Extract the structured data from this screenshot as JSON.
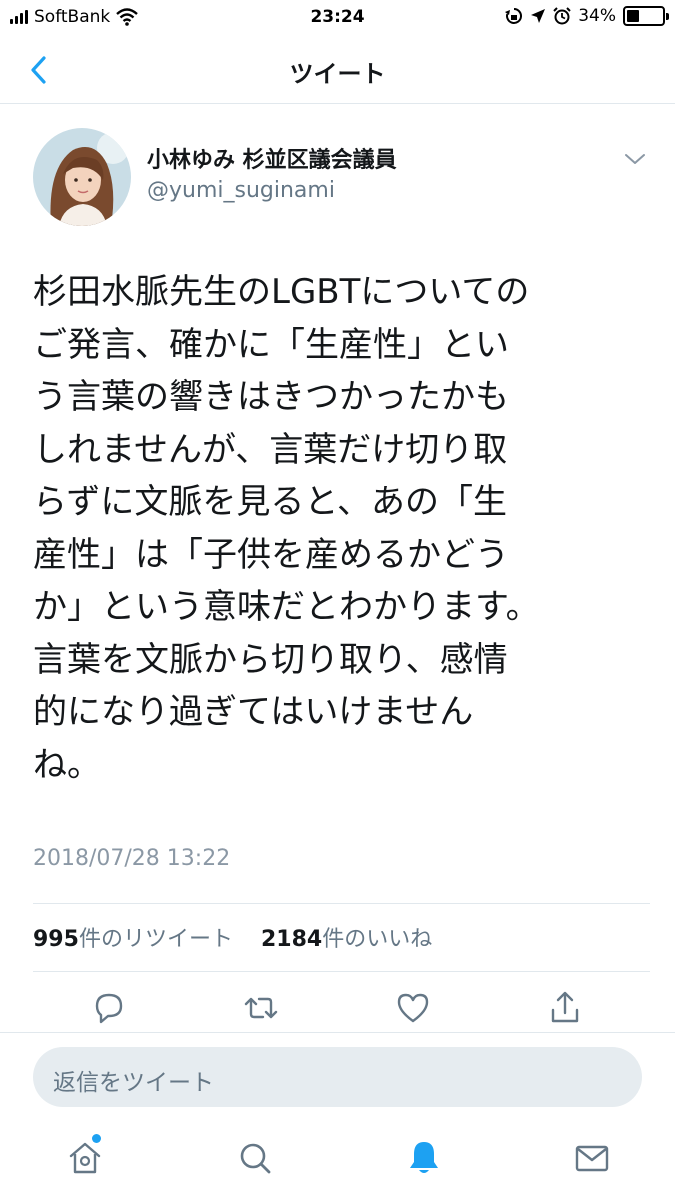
{
  "status_bar": {
    "carrier": "SoftBank",
    "time": "23:24",
    "battery": "34%",
    "battery_level": 0.34
  },
  "nav": {
    "title": "ツイート",
    "back_icon": "chevron-left-icon"
  },
  "tweet": {
    "display_name": "小林ゆみ 杉並区議会議員",
    "handle": "@yumi_suginami",
    "lines": [
      "杉田水脈先生のLGBTについての",
      "ご発言、確かに「生産性」とい",
      "う言葉の響きはきつかったかも",
      "しれませんが、言葉だけ切り取",
      "らずに文脈を見ると、あの「生",
      "産性」は「子供を産めるかどう",
      "か」という意味だとわかります。",
      "言葉を文脈から切り取り、感情",
      "的になり過ぎてはいけません",
      "ね。"
    ],
    "timestamp": "2018/07/28 13:22",
    "retweet_count": "995",
    "retweet_label": "件のリツイート",
    "like_count": "2184",
    "like_label": "件のいいね"
  },
  "actions": [
    "reply-icon",
    "retweet-icon",
    "like-icon",
    "share-icon"
  ],
  "reply": {
    "placeholder": "返信をツイート"
  },
  "tabbar": [
    "home-icon",
    "search-icon",
    "notifications-icon",
    "messages-icon"
  ],
  "colors": {
    "accent": "#1da1f2",
    "text": "#14171a",
    "secondary": "#657786",
    "divider": "#e1e8ed",
    "reply_bg": "#e6ecf0"
  }
}
